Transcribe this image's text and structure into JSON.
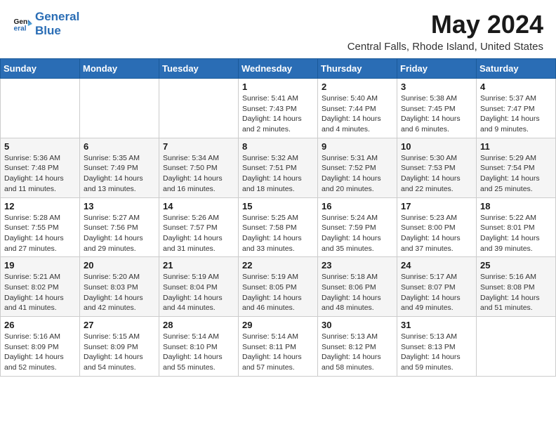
{
  "logo": {
    "name_part1": "General",
    "name_part2": "Blue"
  },
  "header": {
    "month_year": "May 2024",
    "location": "Central Falls, Rhode Island, United States"
  },
  "days_of_week": [
    "Sunday",
    "Monday",
    "Tuesday",
    "Wednesday",
    "Thursday",
    "Friday",
    "Saturday"
  ],
  "weeks": [
    [
      {
        "day": "",
        "sunrise": "",
        "sunset": "",
        "daylight": ""
      },
      {
        "day": "",
        "sunrise": "",
        "sunset": "",
        "daylight": ""
      },
      {
        "day": "",
        "sunrise": "",
        "sunset": "",
        "daylight": ""
      },
      {
        "day": "1",
        "sunrise": "Sunrise: 5:41 AM",
        "sunset": "Sunset: 7:43 PM",
        "daylight": "Daylight: 14 hours and 2 minutes."
      },
      {
        "day": "2",
        "sunrise": "Sunrise: 5:40 AM",
        "sunset": "Sunset: 7:44 PM",
        "daylight": "Daylight: 14 hours and 4 minutes."
      },
      {
        "day": "3",
        "sunrise": "Sunrise: 5:38 AM",
        "sunset": "Sunset: 7:45 PM",
        "daylight": "Daylight: 14 hours and 6 minutes."
      },
      {
        "day": "4",
        "sunrise": "Sunrise: 5:37 AM",
        "sunset": "Sunset: 7:47 PM",
        "daylight": "Daylight: 14 hours and 9 minutes."
      }
    ],
    [
      {
        "day": "5",
        "sunrise": "Sunrise: 5:36 AM",
        "sunset": "Sunset: 7:48 PM",
        "daylight": "Daylight: 14 hours and 11 minutes."
      },
      {
        "day": "6",
        "sunrise": "Sunrise: 5:35 AM",
        "sunset": "Sunset: 7:49 PM",
        "daylight": "Daylight: 14 hours and 13 minutes."
      },
      {
        "day": "7",
        "sunrise": "Sunrise: 5:34 AM",
        "sunset": "Sunset: 7:50 PM",
        "daylight": "Daylight: 14 hours and 16 minutes."
      },
      {
        "day": "8",
        "sunrise": "Sunrise: 5:32 AM",
        "sunset": "Sunset: 7:51 PM",
        "daylight": "Daylight: 14 hours and 18 minutes."
      },
      {
        "day": "9",
        "sunrise": "Sunrise: 5:31 AM",
        "sunset": "Sunset: 7:52 PM",
        "daylight": "Daylight: 14 hours and 20 minutes."
      },
      {
        "day": "10",
        "sunrise": "Sunrise: 5:30 AM",
        "sunset": "Sunset: 7:53 PM",
        "daylight": "Daylight: 14 hours and 22 minutes."
      },
      {
        "day": "11",
        "sunrise": "Sunrise: 5:29 AM",
        "sunset": "Sunset: 7:54 PM",
        "daylight": "Daylight: 14 hours and 25 minutes."
      }
    ],
    [
      {
        "day": "12",
        "sunrise": "Sunrise: 5:28 AM",
        "sunset": "Sunset: 7:55 PM",
        "daylight": "Daylight: 14 hours and 27 minutes."
      },
      {
        "day": "13",
        "sunrise": "Sunrise: 5:27 AM",
        "sunset": "Sunset: 7:56 PM",
        "daylight": "Daylight: 14 hours and 29 minutes."
      },
      {
        "day": "14",
        "sunrise": "Sunrise: 5:26 AM",
        "sunset": "Sunset: 7:57 PM",
        "daylight": "Daylight: 14 hours and 31 minutes."
      },
      {
        "day": "15",
        "sunrise": "Sunrise: 5:25 AM",
        "sunset": "Sunset: 7:58 PM",
        "daylight": "Daylight: 14 hours and 33 minutes."
      },
      {
        "day": "16",
        "sunrise": "Sunrise: 5:24 AM",
        "sunset": "Sunset: 7:59 PM",
        "daylight": "Daylight: 14 hours and 35 minutes."
      },
      {
        "day": "17",
        "sunrise": "Sunrise: 5:23 AM",
        "sunset": "Sunset: 8:00 PM",
        "daylight": "Daylight: 14 hours and 37 minutes."
      },
      {
        "day": "18",
        "sunrise": "Sunrise: 5:22 AM",
        "sunset": "Sunset: 8:01 PM",
        "daylight": "Daylight: 14 hours and 39 minutes."
      }
    ],
    [
      {
        "day": "19",
        "sunrise": "Sunrise: 5:21 AM",
        "sunset": "Sunset: 8:02 PM",
        "daylight": "Daylight: 14 hours and 41 minutes."
      },
      {
        "day": "20",
        "sunrise": "Sunrise: 5:20 AM",
        "sunset": "Sunset: 8:03 PM",
        "daylight": "Daylight: 14 hours and 42 minutes."
      },
      {
        "day": "21",
        "sunrise": "Sunrise: 5:19 AM",
        "sunset": "Sunset: 8:04 PM",
        "daylight": "Daylight: 14 hours and 44 minutes."
      },
      {
        "day": "22",
        "sunrise": "Sunrise: 5:19 AM",
        "sunset": "Sunset: 8:05 PM",
        "daylight": "Daylight: 14 hours and 46 minutes."
      },
      {
        "day": "23",
        "sunrise": "Sunrise: 5:18 AM",
        "sunset": "Sunset: 8:06 PM",
        "daylight": "Daylight: 14 hours and 48 minutes."
      },
      {
        "day": "24",
        "sunrise": "Sunrise: 5:17 AM",
        "sunset": "Sunset: 8:07 PM",
        "daylight": "Daylight: 14 hours and 49 minutes."
      },
      {
        "day": "25",
        "sunrise": "Sunrise: 5:16 AM",
        "sunset": "Sunset: 8:08 PM",
        "daylight": "Daylight: 14 hours and 51 minutes."
      }
    ],
    [
      {
        "day": "26",
        "sunrise": "Sunrise: 5:16 AM",
        "sunset": "Sunset: 8:09 PM",
        "daylight": "Daylight: 14 hours and 52 minutes."
      },
      {
        "day": "27",
        "sunrise": "Sunrise: 5:15 AM",
        "sunset": "Sunset: 8:09 PM",
        "daylight": "Daylight: 14 hours and 54 minutes."
      },
      {
        "day": "28",
        "sunrise": "Sunrise: 5:14 AM",
        "sunset": "Sunset: 8:10 PM",
        "daylight": "Daylight: 14 hours and 55 minutes."
      },
      {
        "day": "29",
        "sunrise": "Sunrise: 5:14 AM",
        "sunset": "Sunset: 8:11 PM",
        "daylight": "Daylight: 14 hours and 57 minutes."
      },
      {
        "day": "30",
        "sunrise": "Sunrise: 5:13 AM",
        "sunset": "Sunset: 8:12 PM",
        "daylight": "Daylight: 14 hours and 58 minutes."
      },
      {
        "day": "31",
        "sunrise": "Sunrise: 5:13 AM",
        "sunset": "Sunset: 8:13 PM",
        "daylight": "Daylight: 14 hours and 59 minutes."
      },
      {
        "day": "",
        "sunrise": "",
        "sunset": "",
        "daylight": ""
      }
    ]
  ]
}
